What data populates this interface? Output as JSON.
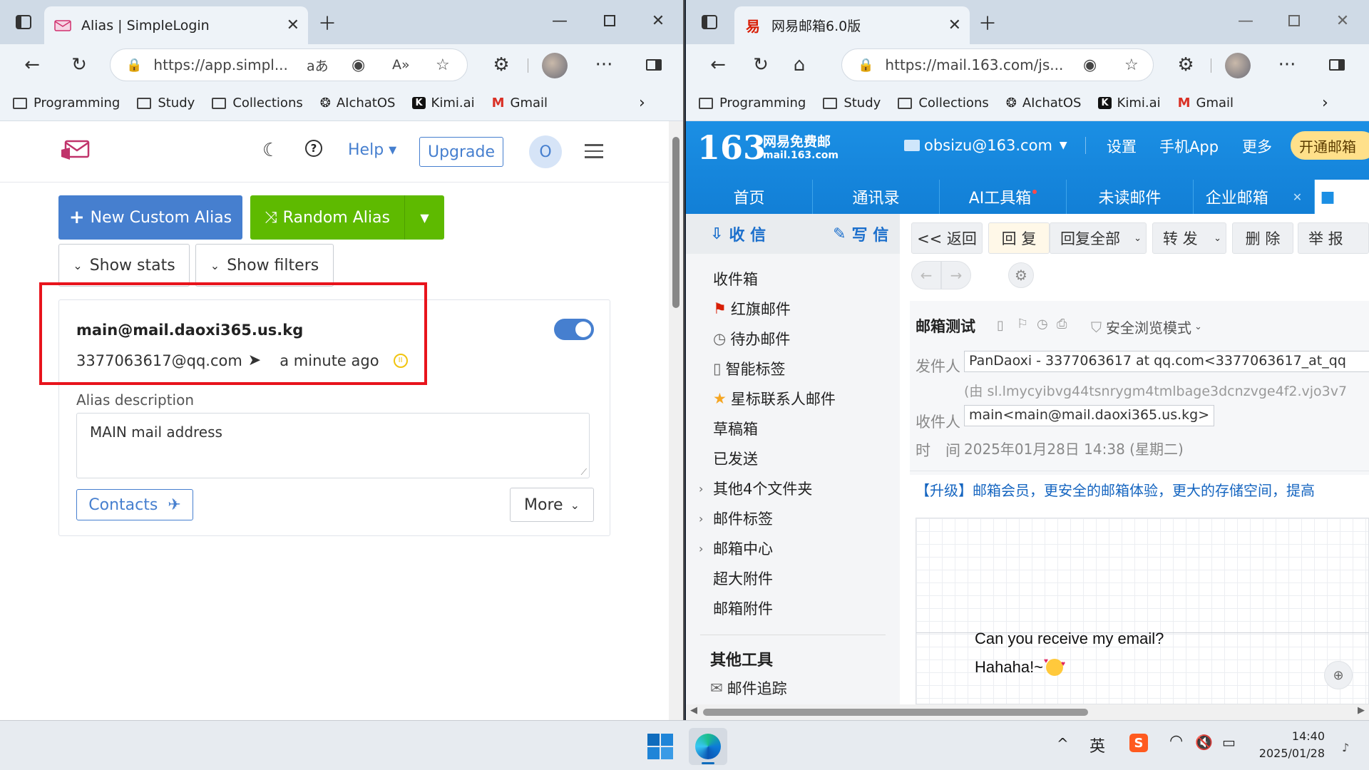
{
  "left_window": {
    "tab_title": "Alias | SimpleLogin",
    "url": "https://app.simpl...",
    "bookmarks": [
      {
        "label": "Programming",
        "icon": "folder-icon"
      },
      {
        "label": "Study",
        "icon": "folder-icon"
      },
      {
        "label": "Collections",
        "icon": "folder-icon"
      },
      {
        "label": "AIchatOS",
        "icon": "openai-icon"
      },
      {
        "label": "Kimi.ai",
        "icon": "kimi-icon"
      },
      {
        "label": "Gmail",
        "icon": "gmail-icon"
      }
    ],
    "app": {
      "help_label": "Help",
      "upgrade_label": "Upgrade",
      "avatar_letter": "O",
      "new_alias_label": "New Custom Alias",
      "random_alias_label": "Random Alias",
      "show_stats_label": "Show stats",
      "show_filters_label": "Show filters",
      "alias": {
        "email": "main@mail.daoxi365.us.kg",
        "mailbox": "3377063617@qq.com",
        "time": "a minute ago",
        "enabled": true,
        "description_label": "Alias description",
        "description_value": "MAIN mail address",
        "contacts_label": "Contacts",
        "more_label": "More"
      },
      "colors": {
        "primary": "#467fcf",
        "success": "#5eba00",
        "highlight": "#e8141c"
      }
    }
  },
  "right_window": {
    "tab_title": "网易邮箱6.0版",
    "url": "https://mail.163.com/js...",
    "bookmarks": [
      {
        "label": "Programming",
        "icon": "folder-icon"
      },
      {
        "label": "Study",
        "icon": "folder-icon"
      },
      {
        "label": "Collections",
        "icon": "folder-icon"
      },
      {
        "label": "AIchatOS",
        "icon": "openai-icon"
      },
      {
        "label": "Kimi.ai",
        "icon": "kimi-icon"
      },
      {
        "label": "Gmail",
        "icon": "gmail-icon"
      }
    ],
    "mail": {
      "logo_number": "163",
      "logo_title": "网易免费邮",
      "logo_domain": "mail.163.com",
      "account": "obsizu@163.com",
      "top_links": [
        "设置",
        "手机App",
        "更多"
      ],
      "vip_button": "开通邮箱",
      "nav_tabs": [
        "首页",
        "通讯录",
        "AI工具箱",
        "未读邮件",
        "企业邮箱"
      ],
      "receive_label": "收 信",
      "compose_label": "写 信",
      "folders": [
        "收件箱",
        "红旗邮件",
        "待办邮件",
        "智能标签",
        "星标联系人邮件",
        "草稿箱",
        "已发送",
        "其他4个文件夹",
        "邮件标签",
        "邮箱中心",
        "超大附件",
        "邮箱附件"
      ],
      "other_tools_label": "其他工具",
      "tool_item": "邮件追踪",
      "toolbar": [
        "<< 返回",
        "回 复",
        "回复全部",
        "转 发",
        "删 除",
        "举 报"
      ],
      "subject": "邮箱测试",
      "safe_mode": "安全浏览模式",
      "from_label": "发件人",
      "from_value": "PanDaoxi - 3377063617 at qq.com<3377063617_at_qq",
      "via_value": "(由 sl.lmycyibvg44tsnrygm4tmlbage3dcnzvge4f2.vjo3v7",
      "to_label": "收件人",
      "to_value": "main<main@mail.daoxi365.us.kg>",
      "time_label": "时　间",
      "time_value": "2025年01月28日 14:38 (星期二)",
      "promo": "【升级】邮箱会员，更安全的邮箱体验，更大的存储空间，提高",
      "body_line1": "Can you receive my email?",
      "body_line2": "Hahaha!~",
      "colors": {
        "brand": "#1b8fe4",
        "link": "#1565c0"
      }
    }
  },
  "taskbar": {
    "ime": "英",
    "time": "14:40",
    "date": "2025/01/28"
  }
}
